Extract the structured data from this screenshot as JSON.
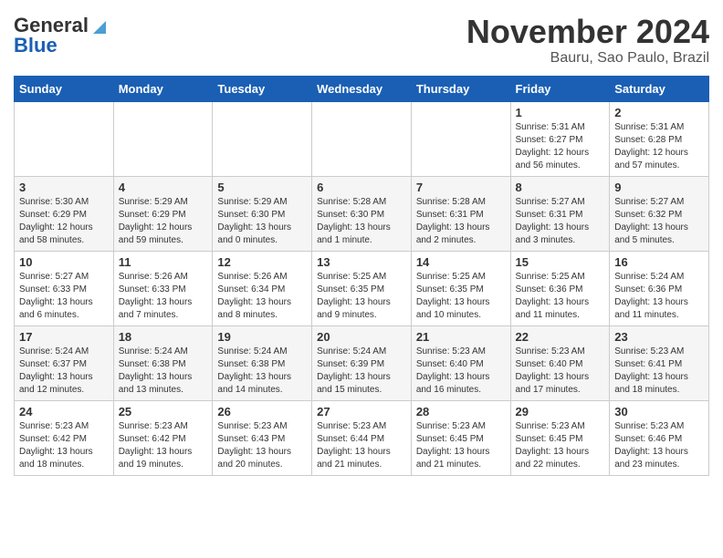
{
  "logo": {
    "general": "General",
    "blue": "Blue"
  },
  "title": "November 2024",
  "subtitle": "Bauru, Sao Paulo, Brazil",
  "days_of_week": [
    "Sunday",
    "Monday",
    "Tuesday",
    "Wednesday",
    "Thursday",
    "Friday",
    "Saturday"
  ],
  "weeks": [
    [
      {
        "day": "",
        "info": ""
      },
      {
        "day": "",
        "info": ""
      },
      {
        "day": "",
        "info": ""
      },
      {
        "day": "",
        "info": ""
      },
      {
        "day": "",
        "info": ""
      },
      {
        "day": "1",
        "info": "Sunrise: 5:31 AM\nSunset: 6:27 PM\nDaylight: 12 hours\nand 56 minutes."
      },
      {
        "day": "2",
        "info": "Sunrise: 5:31 AM\nSunset: 6:28 PM\nDaylight: 12 hours\nand 57 minutes."
      }
    ],
    [
      {
        "day": "3",
        "info": "Sunrise: 5:30 AM\nSunset: 6:29 PM\nDaylight: 12 hours\nand 58 minutes."
      },
      {
        "day": "4",
        "info": "Sunrise: 5:29 AM\nSunset: 6:29 PM\nDaylight: 12 hours\nand 59 minutes."
      },
      {
        "day": "5",
        "info": "Sunrise: 5:29 AM\nSunset: 6:30 PM\nDaylight: 13 hours\nand 0 minutes."
      },
      {
        "day": "6",
        "info": "Sunrise: 5:28 AM\nSunset: 6:30 PM\nDaylight: 13 hours\nand 1 minute."
      },
      {
        "day": "7",
        "info": "Sunrise: 5:28 AM\nSunset: 6:31 PM\nDaylight: 13 hours\nand 2 minutes."
      },
      {
        "day": "8",
        "info": "Sunrise: 5:27 AM\nSunset: 6:31 PM\nDaylight: 13 hours\nand 3 minutes."
      },
      {
        "day": "9",
        "info": "Sunrise: 5:27 AM\nSunset: 6:32 PM\nDaylight: 13 hours\nand 5 minutes."
      }
    ],
    [
      {
        "day": "10",
        "info": "Sunrise: 5:27 AM\nSunset: 6:33 PM\nDaylight: 13 hours\nand 6 minutes."
      },
      {
        "day": "11",
        "info": "Sunrise: 5:26 AM\nSunset: 6:33 PM\nDaylight: 13 hours\nand 7 minutes."
      },
      {
        "day": "12",
        "info": "Sunrise: 5:26 AM\nSunset: 6:34 PM\nDaylight: 13 hours\nand 8 minutes."
      },
      {
        "day": "13",
        "info": "Sunrise: 5:25 AM\nSunset: 6:35 PM\nDaylight: 13 hours\nand 9 minutes."
      },
      {
        "day": "14",
        "info": "Sunrise: 5:25 AM\nSunset: 6:35 PM\nDaylight: 13 hours\nand 10 minutes."
      },
      {
        "day": "15",
        "info": "Sunrise: 5:25 AM\nSunset: 6:36 PM\nDaylight: 13 hours\nand 11 minutes."
      },
      {
        "day": "16",
        "info": "Sunrise: 5:24 AM\nSunset: 6:36 PM\nDaylight: 13 hours\nand 11 minutes."
      }
    ],
    [
      {
        "day": "17",
        "info": "Sunrise: 5:24 AM\nSunset: 6:37 PM\nDaylight: 13 hours\nand 12 minutes."
      },
      {
        "day": "18",
        "info": "Sunrise: 5:24 AM\nSunset: 6:38 PM\nDaylight: 13 hours\nand 13 minutes."
      },
      {
        "day": "19",
        "info": "Sunrise: 5:24 AM\nSunset: 6:38 PM\nDaylight: 13 hours\nand 14 minutes."
      },
      {
        "day": "20",
        "info": "Sunrise: 5:24 AM\nSunset: 6:39 PM\nDaylight: 13 hours\nand 15 minutes."
      },
      {
        "day": "21",
        "info": "Sunrise: 5:23 AM\nSunset: 6:40 PM\nDaylight: 13 hours\nand 16 minutes."
      },
      {
        "day": "22",
        "info": "Sunrise: 5:23 AM\nSunset: 6:40 PM\nDaylight: 13 hours\nand 17 minutes."
      },
      {
        "day": "23",
        "info": "Sunrise: 5:23 AM\nSunset: 6:41 PM\nDaylight: 13 hours\nand 18 minutes."
      }
    ],
    [
      {
        "day": "24",
        "info": "Sunrise: 5:23 AM\nSunset: 6:42 PM\nDaylight: 13 hours\nand 18 minutes."
      },
      {
        "day": "25",
        "info": "Sunrise: 5:23 AM\nSunset: 6:42 PM\nDaylight: 13 hours\nand 19 minutes."
      },
      {
        "day": "26",
        "info": "Sunrise: 5:23 AM\nSunset: 6:43 PM\nDaylight: 13 hours\nand 20 minutes."
      },
      {
        "day": "27",
        "info": "Sunrise: 5:23 AM\nSunset: 6:44 PM\nDaylight: 13 hours\nand 21 minutes."
      },
      {
        "day": "28",
        "info": "Sunrise: 5:23 AM\nSunset: 6:45 PM\nDaylight: 13 hours\nand 21 minutes."
      },
      {
        "day": "29",
        "info": "Sunrise: 5:23 AM\nSunset: 6:45 PM\nDaylight: 13 hours\nand 22 minutes."
      },
      {
        "day": "30",
        "info": "Sunrise: 5:23 AM\nSunset: 6:46 PM\nDaylight: 13 hours\nand 23 minutes."
      }
    ]
  ]
}
